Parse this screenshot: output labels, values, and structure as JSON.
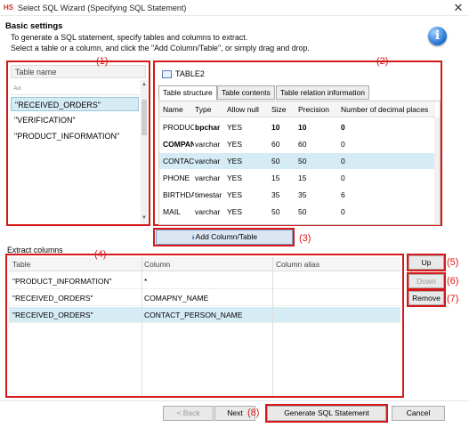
{
  "window": {
    "app_icon": "HS",
    "title": "Select SQL Wizard (Specifying SQL Statement)",
    "close_glyph": "✕"
  },
  "header": {
    "heading": "Basic settings",
    "line1": "To generate a SQL statement, specify tables and columns to extract.",
    "line2": "Select a table or a column, and click the \"Add Column/Table\", or simply drag and drop.",
    "info_glyph": "i"
  },
  "callouts": [
    "(1)",
    "(2)",
    "(3)",
    "(4)",
    "(5)",
    "(6)",
    "(7)",
    "(8)"
  ],
  "table_list": {
    "header": "Table name",
    "filter": "Aa",
    "items": [
      {
        "label": "\"RECEIVED_ORDERS\"",
        "selected": true
      },
      {
        "label": "\"VERIFICATION\"",
        "selected": false
      },
      {
        "label": "\"PRODUCT_INFORMATION\"",
        "selected": false
      }
    ]
  },
  "table_detail": {
    "table_name": "TABLE2",
    "tabs": [
      {
        "label": "Table structure",
        "active": true
      },
      {
        "label": "Table contents",
        "active": false
      },
      {
        "label": "Table relation information",
        "active": false
      }
    ],
    "columns": [
      "Name",
      "Type",
      "Allow null",
      "Size",
      "Precision",
      "Number of decimal places"
    ],
    "rows": [
      {
        "cells": [
          "PRODUC",
          "bpchar",
          "YES",
          "10",
          "10",
          "0"
        ],
        "bold": [
          false,
          true,
          false,
          true,
          true,
          true
        ],
        "selected": false
      },
      {
        "cells": [
          "COMPAN",
          "varchar",
          "YES",
          "60",
          "60",
          "0"
        ],
        "bold": [
          true,
          false,
          false,
          false,
          false,
          false
        ],
        "selected": false
      },
      {
        "cells": [
          "CONTAC",
          "varchar",
          "YES",
          "50",
          "50",
          "0"
        ],
        "bold": [
          false,
          false,
          false,
          false,
          false,
          false
        ],
        "selected": true
      },
      {
        "cells": [
          "PHONE",
          "varchar",
          "YES",
          "15",
          "15",
          "0"
        ],
        "bold": [
          false,
          false,
          false,
          false,
          false,
          false
        ],
        "selected": false
      },
      {
        "cells": [
          "BIRTHDA",
          "timestar",
          "YES",
          "35",
          "35",
          "6"
        ],
        "bold": [
          false,
          false,
          false,
          false,
          false,
          false
        ],
        "selected": false
      },
      {
        "cells": [
          "MAIL",
          "varchar",
          "YES",
          "50",
          "50",
          "0"
        ],
        "bold": [
          false,
          false,
          false,
          false,
          false,
          false
        ],
        "selected": false
      }
    ]
  },
  "add_button": {
    "label": "Add Column/Table",
    "icon": "double-chevron-down-icon"
  },
  "extract": {
    "label": "Extract columns",
    "columns": [
      "Table",
      "Column",
      "Column alias"
    ],
    "rows": [
      {
        "table": "\"PRODUCT_INFORMATION\"",
        "column": "*",
        "alias": "",
        "selected": false
      },
      {
        "table": "\"RECEIVED_ORDERS\"",
        "column": "COMAPNY_NAME",
        "alias": "",
        "selected": false
      },
      {
        "table": "\"RECEIVED_ORDERS\"",
        "column": "CONTACT_PERSON_NAME",
        "alias": "",
        "selected": true
      }
    ]
  },
  "side_buttons": {
    "up": "Up",
    "down": "Down",
    "remove": "Remove"
  },
  "footer": {
    "back": "< Back",
    "next": "Next",
    "generate": "Generate SQL Statement",
    "cancel": "Cancel"
  },
  "colors": {
    "callout_red": "#d61818",
    "selection": "#d6ecf5",
    "accent_blue": "#1f6fd1"
  }
}
